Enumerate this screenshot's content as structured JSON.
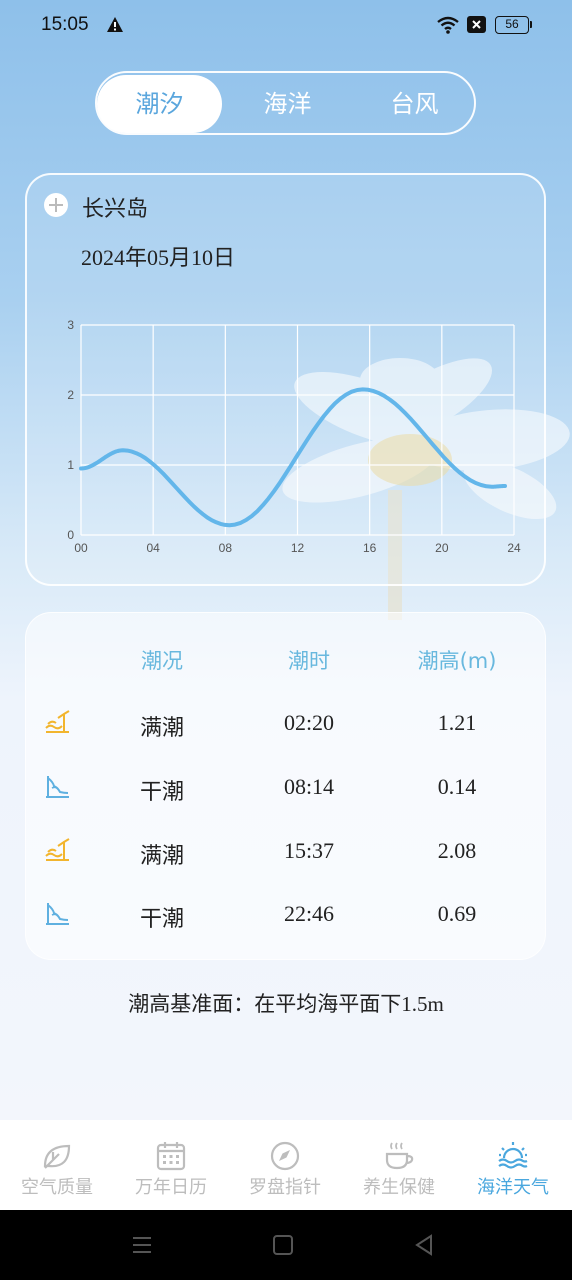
{
  "status_bar": {
    "time": "15:05",
    "battery": "56"
  },
  "tabs": [
    {
      "label": "潮汐",
      "active": true
    },
    {
      "label": "海洋",
      "active": false
    },
    {
      "label": "台风",
      "active": false
    }
  ],
  "location": "长兴岛",
  "date": "2024年05月10日",
  "chart_data": {
    "type": "line",
    "x_ticks": [
      "00",
      "04",
      "08",
      "12",
      "16",
      "20",
      "24"
    ],
    "y_ticks": [
      "0",
      "1",
      "2",
      "3"
    ],
    "ylim": [
      0,
      3
    ],
    "xlim": [
      0,
      24
    ],
    "grid": true,
    "series": [
      {
        "x": [
          0.0,
          2.33,
          8.23,
          15.62,
          22.77,
          23.5
        ],
        "y": [
          0.95,
          1.21,
          0.14,
          2.08,
          0.69,
          0.7
        ]
      }
    ],
    "color": "#63b6ea"
  },
  "table": {
    "headers": [
      "潮况",
      "潮时",
      "潮高(m)"
    ],
    "rows": [
      {
        "type": "满潮",
        "time": "02:20",
        "height": "1.21",
        "icon": "high-tide-icon"
      },
      {
        "type": "干潮",
        "time": "08:14",
        "height": "0.14",
        "icon": "low-tide-icon"
      },
      {
        "type": "满潮",
        "time": "15:37",
        "height": "2.08",
        "icon": "high-tide-icon"
      },
      {
        "type": "干潮",
        "time": "22:46",
        "height": "0.69",
        "icon": "low-tide-icon"
      }
    ]
  },
  "datum_note": "潮高基准面：在平均海平面下1.5m",
  "bottom_nav": [
    {
      "label": "空气质量",
      "icon": "leaf-icon",
      "active": false
    },
    {
      "label": "万年日历",
      "icon": "calendar-icon",
      "active": false
    },
    {
      "label": "罗盘指针",
      "icon": "compass-icon",
      "active": false
    },
    {
      "label": "养生保健",
      "icon": "tea-cup-icon",
      "active": false
    },
    {
      "label": "海洋天气",
      "icon": "sea-sun-icon",
      "active": true
    }
  ],
  "colors": {
    "accent": "#4aa7de",
    "high_tide": "#f2b52e",
    "low_tide": "#5fb0e0"
  }
}
